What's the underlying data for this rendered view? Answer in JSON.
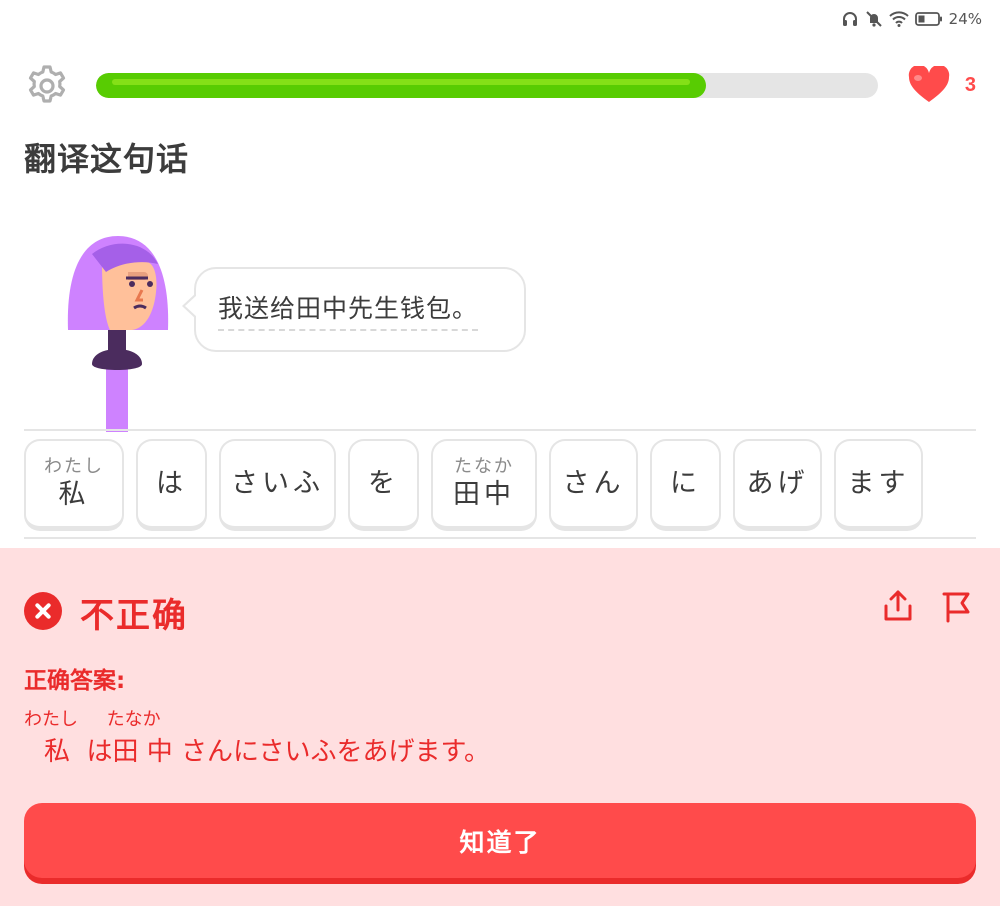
{
  "status_bar": {
    "battery_percent": "24%",
    "icons": [
      "headphones-icon",
      "mute-icon",
      "wifi-icon",
      "battery-icon"
    ]
  },
  "top_bar": {
    "settings_icon": "gear-icon",
    "progress_fraction": 0.78,
    "hearts_count": "3",
    "colors": {
      "progress": "#58cc02",
      "heart": "#ff4b4b"
    }
  },
  "prompt": {
    "title": "翻译这句话",
    "sentence": "我送给田中先生钱包。"
  },
  "answer_tiles": [
    {
      "ruby": "わたし",
      "word": "私"
    },
    {
      "ruby": "",
      "word": "は"
    },
    {
      "ruby": "",
      "word": "さいふ"
    },
    {
      "ruby": "",
      "word": "を"
    },
    {
      "ruby": "たなか",
      "word": "田中"
    },
    {
      "ruby": "",
      "word": "さん"
    },
    {
      "ruby": "",
      "word": "に"
    },
    {
      "ruby": "",
      "word": "あげ"
    },
    {
      "ruby": "",
      "word": "ます"
    }
  ],
  "feedback": {
    "title": "不正确",
    "correct_answer_label": "正确答案:",
    "ruby_line": "わたし     たなか",
    "correct_answer": "私  は田 中 さんにさいふをあげます。",
    "continue_label": "知道了",
    "colors": {
      "background": "#ffdfe0",
      "accent": "#ea2b2b",
      "button": "#ff4b4b"
    }
  }
}
